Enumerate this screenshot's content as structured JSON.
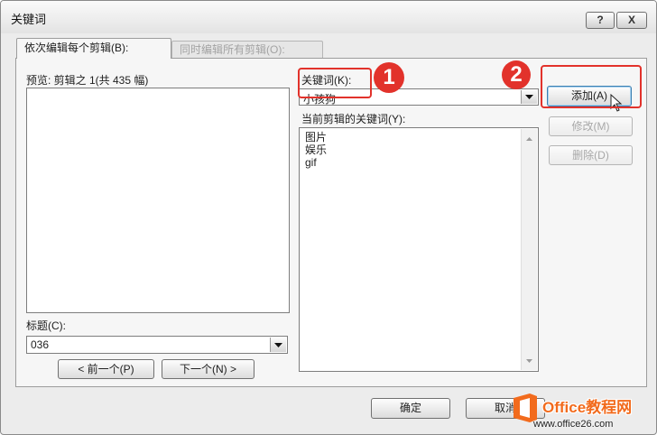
{
  "window": {
    "title": "关键词",
    "help_label": "?",
    "close_label": "X"
  },
  "tabs": [
    {
      "label": "依次编辑每个剪辑(B):",
      "active": true
    },
    {
      "label": "同时编辑所有剪辑(O):",
      "active": false
    }
  ],
  "preview": {
    "label": "预览: 剪辑之 1(共 435 幅)"
  },
  "caption": {
    "label": "标题(C):",
    "value": "036"
  },
  "nav": {
    "prev_label": "< 前一个(P)",
    "next_label": "下一个(N) >"
  },
  "keyword": {
    "label": "关键词(K):",
    "value": "小孩狗"
  },
  "current_keywords": {
    "label": "当前剪辑的关键词(Y):",
    "items": [
      "图片",
      "娱乐",
      "gif"
    ]
  },
  "actions": {
    "add_label": "添加(A)",
    "modify_label": "修改(M)",
    "delete_label": "删除(D)"
  },
  "footer": {
    "ok_label": "确定",
    "cancel_label": "取消"
  },
  "annotations": {
    "step1": "1",
    "step2": "2"
  },
  "watermark": {
    "brand": "Office教程网",
    "url": "www.office26.com"
  },
  "icons": {
    "dropdown": "chevron-down-icon",
    "scroll_up": "scroll-up-arrow-icon",
    "scroll_down": "scroll-down-arrow-icon",
    "cursor": "mouse-cursor-icon",
    "logo": "office-logo-icon"
  },
  "colors": {
    "annotation": "#e2322b",
    "watermark": "#f26b1d",
    "default_button_border": "#3c7fb1"
  }
}
